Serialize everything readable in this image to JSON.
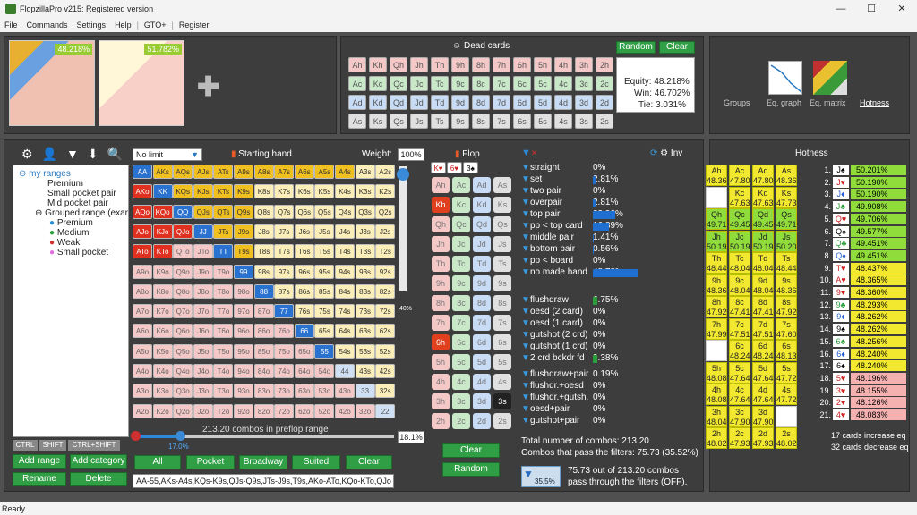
{
  "app": {
    "title": "FlopzillaPro v215: Registered version",
    "status": "Ready"
  },
  "menu": [
    "File",
    "Commands",
    "Settings",
    "Help",
    "|",
    "GTO+",
    "|",
    "Register"
  ],
  "players": [
    {
      "equity": "48.218%"
    },
    {
      "equity": "51.782%"
    }
  ],
  "dead_cards": {
    "title": "Dead cards",
    "random": "Random",
    "clear": "Clear",
    "rows": [
      [
        "Ah",
        "Kh",
        "Qh",
        "Jh",
        "Th",
        "9h",
        "8h",
        "7h",
        "6h",
        "5h",
        "4h",
        "3h",
        "2h"
      ],
      [
        "Ac",
        "Kc",
        "Qc",
        "Jc",
        "Tc",
        "9c",
        "8c",
        "7c",
        "6c",
        "5c",
        "4c",
        "3c",
        "2c"
      ],
      [
        "Ad",
        "Kd",
        "Qd",
        "Jd",
        "Td",
        "9d",
        "8d",
        "7d",
        "6d",
        "5d",
        "4d",
        "3d",
        "2d"
      ],
      [
        "As",
        "Ks",
        "Qs",
        "Js",
        "Ts",
        "9s",
        "8s",
        "7s",
        "6s",
        "5s",
        "4s",
        "3s",
        "2s"
      ]
    ],
    "equity": "Equity: 48.218%",
    "win": "Win: 46.702%",
    "tie": "Tie: 3.031%"
  },
  "views": [
    "Groups",
    "Eq. graph",
    "Eq. matrix",
    "Hotness"
  ],
  "range": {
    "limit": "No limit",
    "starting_hand": "Starting hand",
    "weight_label": "Weight:",
    "weight": "100%",
    "combos": "213.20 combos in preflop range",
    "pct": "18.1%",
    "slider_val": "17.0%",
    "side_pct": "40%",
    "buttons": [
      "All",
      "Pocket",
      "Broadway",
      "Suited",
      "Clear"
    ],
    "text": "AA-55,AKs-A4s,KQs-K9s,QJs-Q9s,JTs-J9s,T9s,AKo-ATo,KQo-KTo,QJo"
  },
  "tree": {
    "root": "my ranges",
    "items": [
      "Premium",
      "Small pocket pair",
      "Mid pocket pair",
      "Grouped range (exar"
    ],
    "sub": [
      {
        "label": "Premium",
        "color": "#2d8fd0"
      },
      {
        "label": "Medium",
        "color": "#2a9e3a"
      },
      {
        "label": "Weak",
        "color": "#d03030"
      },
      {
        "label": "Small pocket",
        "color": "#e070e0"
      }
    ]
  },
  "left_buttons": {
    "ctrl": "CTRL",
    "shift": "SHIFT",
    "ctrlshift": "CTRL+SHIFT",
    "add_range": "Add range",
    "add_category": "Add category",
    "rename": "Rename",
    "delete": "Delete"
  },
  "flop": {
    "title": "Flop",
    "board": [
      "K♥",
      "6♥",
      "3♠"
    ],
    "clear": "Clear",
    "random": "Random"
  },
  "stats": {
    "inv": "Inv",
    "rows": [
      {
        "label": "straight",
        "v": "0%",
        "f": 0
      },
      {
        "label": "set",
        "v": "2.81%",
        "f": 0.04
      },
      {
        "label": "two pair",
        "v": "0%",
        "f": 0
      },
      {
        "label": "overpair",
        "v": "2.81%",
        "f": 0.04
      },
      {
        "label": "top pair",
        "v": "23.92%",
        "f": 0.35
      },
      {
        "label": "pp < top card",
        "v": "16.89%",
        "f": 0.25
      },
      {
        "label": "middle pair",
        "v": "1.41%",
        "f": 0.02
      },
      {
        "label": "bottom pair",
        "v": "0.56%",
        "f": 0.01
      },
      {
        "label": "pp < board",
        "v": "0%",
        "f": 0
      },
      {
        "label": "no made hand",
        "v": "48.78%",
        "f": 0.72
      }
    ],
    "draws": [
      {
        "label": "flushdraw",
        "v": "6.75%",
        "f": 0.1
      },
      {
        "label": "oesd (2 card)",
        "v": "0%",
        "f": 0
      },
      {
        "label": "oesd (1 card)",
        "v": "0%",
        "f": 0
      },
      {
        "label": "gutshot (2 crd)",
        "v": "0%",
        "f": 0
      },
      {
        "label": "gutshot (1 crd)",
        "v": "0%",
        "f": 0
      },
      {
        "label": "2 crd bckdr fd",
        "v": "9.38%",
        "f": 0.14
      },
      {
        "label": "flushdraw+pair",
        "v": "0.19%",
        "f": 0
      },
      {
        "label": "flushdr.+oesd",
        "v": "0%",
        "f": 0
      },
      {
        "label": "flushdr.+gutsh.",
        "v": "0%",
        "f": 0
      },
      {
        "label": "oesd+pair",
        "v": "0%",
        "f": 0
      },
      {
        "label": "gutshot+pair",
        "v": "0%",
        "f": 0
      }
    ],
    "total": "Total number of combos: 213.20",
    "pass": "Combos that pass the filters: 75.73 (35.52%)",
    "filter_pct": "35.5%",
    "footer1": "75.73 out of 213.20 combos",
    "footer2": "pass through the filters (OFF)."
  },
  "hotness": {
    "title": "Hotness",
    "cards": [
      [
        "Ah",
        "48.36"
      ],
      [
        "Ac",
        "47.80"
      ],
      [
        "Ad",
        "47.80"
      ],
      [
        "As",
        "48.36"
      ],
      [
        "",
        ""
      ],
      [
        "Kc",
        "47.63"
      ],
      [
        "Kd",
        "47.63"
      ],
      [
        "Ks",
        "47.73"
      ],
      [
        "Qh",
        "49.71"
      ],
      [
        "Qc",
        "49.45"
      ],
      [
        "Qd",
        "49.45"
      ],
      [
        "Qs",
        "49.71"
      ],
      [
        "Jh",
        "50.19"
      ],
      [
        "Jc",
        "50.19"
      ],
      [
        "Jd",
        "50.19"
      ],
      [
        "Js",
        "50.20"
      ],
      [
        "Th",
        "48.44"
      ],
      [
        "Tc",
        "48.04"
      ],
      [
        "Td",
        "48.04"
      ],
      [
        "Ts",
        "48.44"
      ],
      [
        "9h",
        "48.36"
      ],
      [
        "9c",
        "48.04"
      ],
      [
        "9d",
        "48.04"
      ],
      [
        "9s",
        "48.36"
      ],
      [
        "8h",
        "47.92"
      ],
      [
        "8c",
        "47.41"
      ],
      [
        "8d",
        "47.41"
      ],
      [
        "8s",
        "47.92"
      ],
      [
        "7h",
        "47.99"
      ],
      [
        "7c",
        "47.51"
      ],
      [
        "7d",
        "47.51"
      ],
      [
        "7s",
        "47.60"
      ],
      [
        "",
        ""
      ],
      [
        "6c",
        "48.24"
      ],
      [
        "6d",
        "48.24"
      ],
      [
        "6s",
        "48.13"
      ],
      [
        "5h",
        "48.08"
      ],
      [
        "5c",
        "47.64"
      ],
      [
        "5d",
        "47.64"
      ],
      [
        "5s",
        "47.72"
      ],
      [
        "4h",
        "48.08"
      ],
      [
        "4c",
        "47.64"
      ],
      [
        "4d",
        "47.64"
      ],
      [
        "4s",
        "47.72"
      ],
      [
        "3h",
        "48.04"
      ],
      [
        "3c",
        "47.90"
      ],
      [
        "3d",
        "47.90"
      ],
      [
        "",
        ""
      ],
      [
        "2h",
        "48.02"
      ],
      [
        "2c",
        "47.93"
      ],
      [
        "2d",
        "47.93"
      ],
      [
        "2s",
        "48.02"
      ]
    ],
    "list": [
      [
        "1.",
        "J♠",
        "50.201%"
      ],
      [
        "2.",
        "J♥",
        "50.190%"
      ],
      [
        "3.",
        "J♦",
        "50.190%"
      ],
      [
        "4.",
        "J♣",
        "49.908%"
      ],
      [
        "5.",
        "Q♥",
        "49.706%"
      ],
      [
        "6.",
        "Q♠",
        "49.577%"
      ],
      [
        "7.",
        "Q♣",
        "49.451%"
      ],
      [
        "8.",
        "Q♦",
        "49.451%"
      ],
      [
        "9.",
        "T♥",
        "48.437%"
      ],
      [
        "10.",
        "A♥",
        "48.365%"
      ],
      [
        "11.",
        "9♥",
        "48.360%"
      ],
      [
        "12.",
        "9♣",
        "48.293%"
      ],
      [
        "13.",
        "9♦",
        "48.262%"
      ],
      [
        "14.",
        "9♠",
        "48.262%"
      ],
      [
        "15.",
        "6♣",
        "48.256%"
      ],
      [
        "16.",
        "6♦",
        "48.240%"
      ],
      [
        "17.",
        "6♠",
        "48.240%"
      ],
      [
        "18.",
        "5♥",
        "48.196%"
      ],
      [
        "19.",
        "3♥",
        "48.155%"
      ],
      [
        "20.",
        "2♥",
        "48.126%"
      ],
      [
        "21.",
        "4♥",
        "48.083%"
      ]
    ],
    "inc": "17 cards increase eq",
    "dec": "32 cards decrease eq"
  }
}
